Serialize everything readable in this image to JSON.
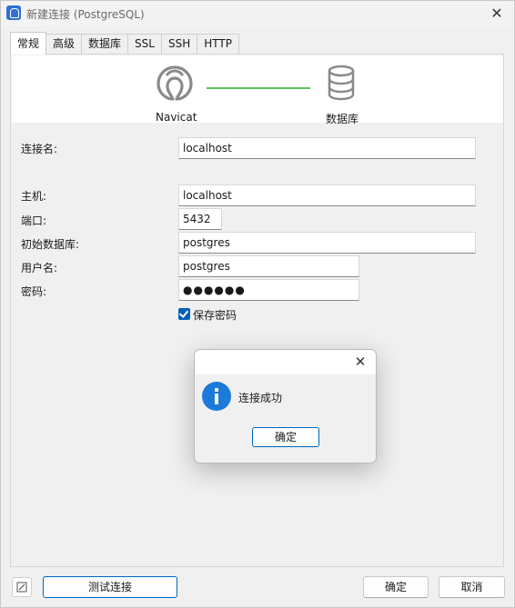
{
  "window": {
    "title": "新建连接 (PostgreSQL)",
    "close_glyph": "✕"
  },
  "tabs": [
    {
      "label": "常规",
      "active": true
    },
    {
      "label": "高级",
      "active": false
    },
    {
      "label": "数据库",
      "active": false
    },
    {
      "label": "SSL",
      "active": false
    },
    {
      "label": "SSH",
      "active": false
    },
    {
      "label": "HTTP",
      "active": false
    }
  ],
  "banner": {
    "left_label": "Navicat",
    "right_label": "数据库",
    "left_icon": "navicat-logo-icon",
    "right_icon": "database-icon",
    "line_color": "#58c85a"
  },
  "form": {
    "connection_name": {
      "label": "连接名:",
      "value": "localhost"
    },
    "host": {
      "label": "主机:",
      "value": "localhost"
    },
    "port": {
      "label": "端口:",
      "value": "5432"
    },
    "initial_db": {
      "label": "初始数据库:",
      "value": "postgres"
    },
    "username": {
      "label": "用户名:",
      "value": "postgres"
    },
    "password": {
      "label": "密码:",
      "value": "●●●●●●"
    },
    "save_password": {
      "label": "保存密码",
      "checked": true
    }
  },
  "buttons": {
    "test_connection": "测试连接",
    "ok": "确定",
    "cancel": "取消"
  },
  "dialog": {
    "message": "连接成功",
    "ok": "确定",
    "icon": "info-icon",
    "close_glyph": "✕"
  },
  "colors": {
    "accent": "#005fb8",
    "info_icon": "#1c7ad8"
  }
}
